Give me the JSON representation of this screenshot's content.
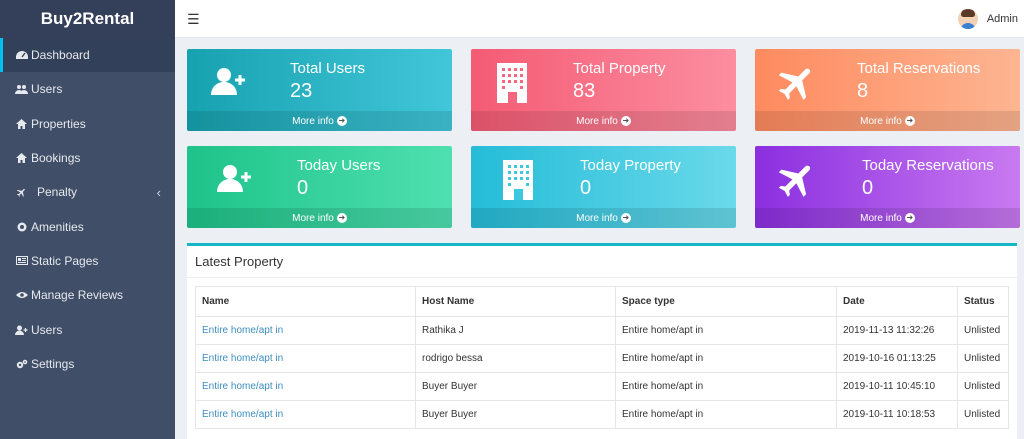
{
  "brand": "Buy2Rental",
  "sidebar": {
    "items": [
      {
        "label": "Dashboard",
        "icon": "dashboard-icon"
      },
      {
        "label": "Users",
        "icon": "users-icon"
      },
      {
        "label": "Properties",
        "icon": "home-icon"
      },
      {
        "label": "Bookings",
        "icon": "home-icon"
      },
      {
        "label": "Penalty",
        "icon": "plane-icon"
      },
      {
        "label": "Amenities",
        "icon": "circle-icon"
      },
      {
        "label": "Static Pages",
        "icon": "newspaper-icon"
      },
      {
        "label": "Manage Reviews",
        "icon": "eye-icon"
      },
      {
        "label": "Users",
        "icon": "user-plus-icon"
      },
      {
        "label": "Settings",
        "icon": "cogs-icon"
      }
    ]
  },
  "header": {
    "user": "Admin"
  },
  "cards": [
    {
      "title": "Total Users",
      "value": "23",
      "more": "More info"
    },
    {
      "title": "Total Property",
      "value": "83",
      "more": "More info"
    },
    {
      "title": "Total Reservations",
      "value": "8",
      "more": "More info"
    },
    {
      "title": "Today Users",
      "value": "0",
      "more": "More info"
    },
    {
      "title": "Today Property",
      "value": "0",
      "more": "More info"
    },
    {
      "title": "Today Reservations",
      "value": "0",
      "more": "More info"
    }
  ],
  "latest": {
    "title": "Latest Property",
    "columns": [
      "Name",
      "Host Name",
      "Space type",
      "Date",
      "Status"
    ],
    "rows": [
      [
        "Entire home/apt in",
        "Rathika J",
        "Entire home/apt in",
        "2019-11-13 11:32:26",
        "Unlisted"
      ],
      [
        "Entire home/apt in",
        "rodrigo bessa",
        "Entire home/apt in",
        "2019-10-16 01:13:25",
        "Unlisted"
      ],
      [
        "Entire home/apt in",
        "Buyer Buyer",
        "Entire home/apt in",
        "2019-10-11 10:45:10",
        "Unlisted"
      ],
      [
        "Entire home/apt in",
        "Buyer Buyer",
        "Entire home/apt in",
        "2019-10-11 10:18:53",
        "Unlisted"
      ]
    ]
  },
  "colors": {
    "sidebar": "#404e67",
    "accent": "#17b6c6",
    "link": "#3c8dbc"
  }
}
